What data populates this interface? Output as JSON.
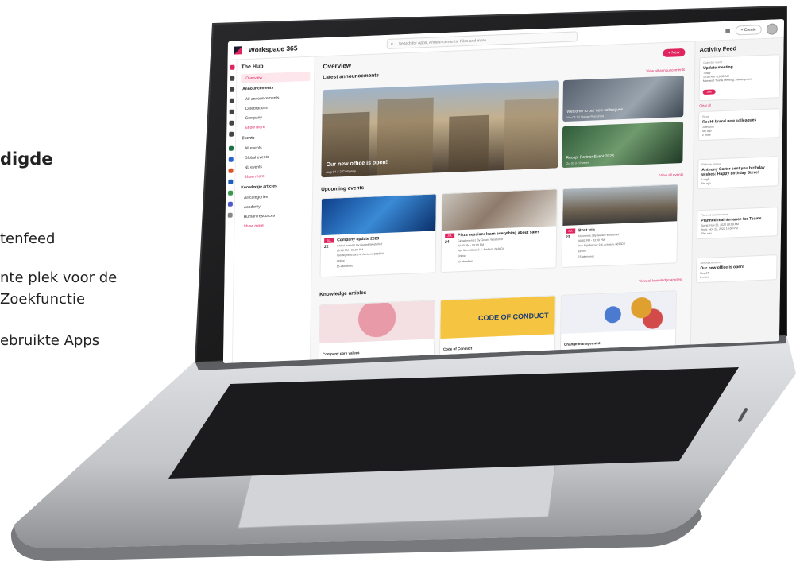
{
  "marketing": {
    "heading": "digde",
    "items": [
      "tenfeed",
      "nte plek voor de",
      "Zoekfunctie",
      "ebruikte Apps"
    ]
  },
  "app": {
    "title": "Workspace 365",
    "search_placeholder": "Search for Apps, Announcements, Files and more...",
    "create_label": "+ Create"
  },
  "nav": {
    "hub_title": "The Hub",
    "overview": "Overview",
    "announcements": "Announcements",
    "all_announcements": "All announcements",
    "celebrations": "Celebrations",
    "company": "Company",
    "show_more_1": "Show more",
    "events": "Events",
    "all_events": "All events",
    "global_events": "Global events",
    "nl_events": "NL events",
    "show_more_2": "Show more",
    "knowledge_articles": "Knowledge articles",
    "all_categories": "All categories",
    "academy": "Academy",
    "human_resources": "Human resources",
    "show_more_3": "Show more"
  },
  "main": {
    "overview_title": "Overview",
    "new_button": "+ New",
    "latest_announcements": "Latest announcements",
    "view_all_announcements": "View all announcements",
    "ann_main_title": "Our new office is open!",
    "ann_main_meta": "Aug 04   3   2   Company",
    "ann_small_1_title": "Welcome to our new colleagues",
    "ann_small_1_meta": "Nov 03   1   2   Human Resources",
    "ann_small_2_title": "Recap: Partner Event 2023",
    "ann_small_2_meta": "Oct 03   3   2   Partner",
    "upcoming_events": "Upcoming events",
    "view_all_events": "View all events",
    "events": [
      {
        "month": "JUL",
        "day": "22",
        "title": "Company update 2023",
        "line1": "Global events | By Gerard Westerhof",
        "line2": "09:00 PM - 03:00 PM",
        "line3": "Van Nijmbstraat 2-4, Arnhem, 6836DV",
        "line4": "Online",
        "line5": "15 attendees"
      },
      {
        "month": "JUL",
        "day": "24",
        "title": "Pizza session: learn everything about sales",
        "line1": "Global events | By Gerard Westerhof",
        "line2": "03:00 PM - 09:00 PM",
        "line3": "Van Nijmbstraat 2-4, Arnhem, 6836DV",
        "line4": "Online",
        "line5": "22 attendees"
      },
      {
        "month": "JUL",
        "day": "23",
        "title": "Boat trip",
        "line1": "NL events | By Gerard Westerhof",
        "line2": "09:00 PM - 03:00 PM",
        "line3": "Van Nijmbstraat 2-4, Arnhem, 6836DV",
        "line4": "Online",
        "line5": "75 attendees"
      }
    ],
    "knowledge_articles": "Knowledge articles",
    "view_all_knowledge": "View all knowledge articles",
    "ka": [
      {
        "title": "Company core values"
      },
      {
        "title": "Code of Conduct",
        "img_text": "CODE OF CONDUCT"
      },
      {
        "title": "Change management"
      }
    ]
  },
  "feed": {
    "title": "Activity Feed",
    "cal_type": "Calendar event",
    "cal_head": "Update meeting",
    "cal_l1": "Today",
    "cal_l2": "10:00 AM - 10:30 AM",
    "cal_l3": "Microsoft Teams Meeting; Meetingroom",
    "join": "Join",
    "clear_all": "Clear all",
    "email_type": "Email",
    "email_head": "Re: Hi brand new colleagues",
    "email_l1": "John Doe",
    "email_l2": "4m ago",
    "email_more": "2 more",
    "bday_type": "Birthday wishes",
    "bday_head": "Anthony Carter sent you birthday wishes: Happy birthday Steve!",
    "bday_react": "Laugh",
    "bday_time": "5m ago",
    "maint_type": "Planned maintenance",
    "maint_head": "Planned maintenance for Teams",
    "maint_l1": "Starts: Nov 22, 2022 08:00 AM",
    "maint_l2": "Ends: Nov 22, 2022 10:00 PM",
    "maint_time": "20m ago",
    "ann_type": "Announcements",
    "ann_head": "Our new office is open!",
    "ann_l1": "Nov 04",
    "ann_more": "2 more"
  },
  "colors": {
    "accent": "#e0245e",
    "laptop_silver": "#c9cbcf",
    "bezel": "#111111"
  }
}
